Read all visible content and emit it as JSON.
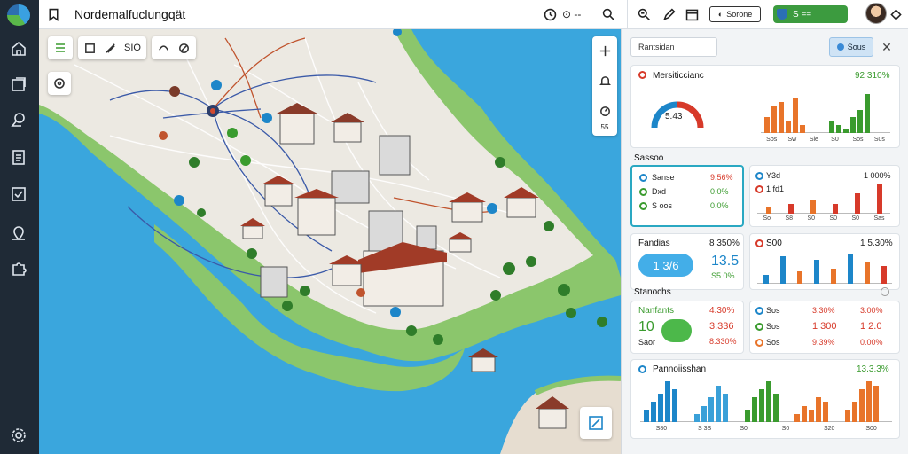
{
  "app": {
    "title": "Nordemalfuclungqät"
  },
  "topbar": {
    "status_text": "⊙ --",
    "pill_label": "Sorone",
    "green_label": "S ==",
    "avatar_name": "user-avatar"
  },
  "map_tools": {
    "zoom_label": "SIO",
    "zoom_out_label": "55"
  },
  "panel": {
    "search_placeholder": "Rantsidan",
    "blue_button": "Sous",
    "close_label": "✕",
    "card1": {
      "title": "Mersiticcianc",
      "value": "92 310%",
      "gauge_label": "5.43",
      "ticks": [
        "Sos",
        "Sw",
        "Sie",
        "S0",
        "Sos",
        "S0s"
      ]
    },
    "section1": "Sassoo",
    "card2": {
      "rows": [
        {
          "label": "Sanse",
          "value": "9.56%"
        },
        {
          "label": "Dxd",
          "value": "0.0%"
        },
        {
          "label": "S oos",
          "value": "0.0%"
        }
      ]
    },
    "card3": {
      "rows": [
        {
          "label": "Y3d",
          "value": "1 000%"
        },
        {
          "label": "1 fd1",
          "value": ""
        }
      ],
      "ticks": [
        "So",
        "S8",
        "S0",
        "S0",
        "S0",
        "Sas"
      ]
    },
    "card4": {
      "title": "Fandias",
      "value": "8 350%",
      "pill_value": "1 3/6",
      "big_value": "13.5",
      "sub": "S5 0%"
    },
    "card5": {
      "title": "S00",
      "value": "1 5.30%"
    },
    "section2": "Stanochs",
    "card6": {
      "title": "Nanfants",
      "value": "4.30%",
      "big_value": "10",
      "sub_label": "Saor",
      "mid_value": "3.336",
      "mid_value2": "8.330%"
    },
    "card7": {
      "rows": [
        {
          "label": "Sos",
          "value1": "3.30%",
          "value2": "3.00%"
        },
        {
          "label": "Sos",
          "value1": "1 300",
          "value2": "1 2.0"
        },
        {
          "label": "Sos",
          "value1": "9.39%",
          "value2": "0.00%"
        }
      ]
    },
    "card8": {
      "title": "Pannoiisshan",
      "value": "13.3.3%",
      "ticks": [
        "S80",
        "S 3S",
        "S0",
        "S0",
        "S20",
        "S00"
      ]
    }
  },
  "colors": {
    "accent_blue": "#1d86c9",
    "green": "#3a9b2e",
    "red": "#d73a2a",
    "orange": "#e8742a"
  },
  "chart_data": [
    {
      "type": "bar",
      "series": [
        {
          "values": [
            4,
            7,
            8,
            3,
            9,
            2
          ]
        },
        {
          "values": [
            3,
            2,
            1,
            4,
            6,
            10
          ]
        }
      ]
    },
    {
      "type": "bar",
      "series": [
        {
          "values": [
            2,
            3,
            4,
            3,
            6,
            9
          ]
        }
      ]
    },
    {
      "type": "bar",
      "series": [
        {
          "values": [
            3,
            9,
            4,
            8,
            5,
            10,
            7,
            6
          ]
        }
      ]
    },
    {
      "type": "bar",
      "series": [
        {
          "values": [
            3,
            5,
            7,
            10,
            8
          ]
        },
        {
          "values": [
            2,
            4,
            6,
            9,
            7
          ]
        },
        {
          "values": [
            3,
            6,
            8,
            10,
            7
          ]
        },
        {
          "values": [
            2,
            4,
            3,
            6,
            5
          ]
        },
        {
          "values": [
            3,
            5,
            8,
            10,
            9
          ]
        }
      ]
    }
  ]
}
